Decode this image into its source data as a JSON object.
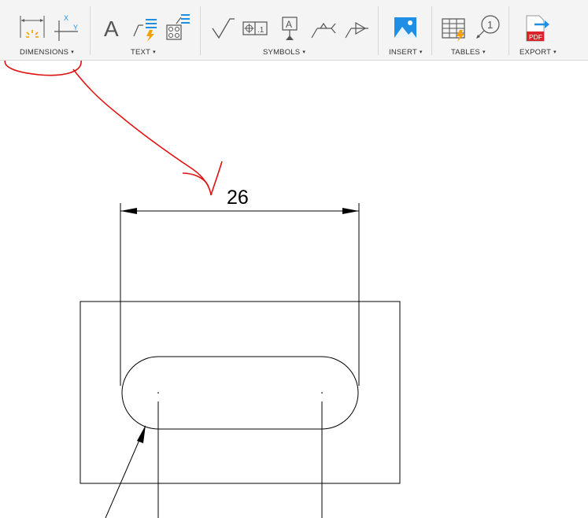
{
  "toolbar": {
    "groups": [
      {
        "label": "DIMENSIONS",
        "icons": [
          "linear-dimension-icon",
          "ordinate-dimension-icon"
        ]
      },
      {
        "label": "TEXT",
        "icons": [
          "text-icon",
          "leader-text-icon",
          "hole-thread-note-icon"
        ]
      },
      {
        "label": "SYMBOLS",
        "icons": [
          "surface-texture-icon",
          "feature-control-frame-icon",
          "datum-identifier-icon",
          "welding-symbol-icon",
          "taper-slope-icon"
        ]
      },
      {
        "label": "INSERT",
        "icons": [
          "insert-image-icon"
        ]
      },
      {
        "label": "TABLES",
        "icons": [
          "table-icon",
          "balloon-icon"
        ]
      },
      {
        "label": "EXPORT",
        "icons": [
          "export-pdf-icon"
        ]
      }
    ],
    "caret": "▾",
    "icon_glyphs": {
      "text": "A",
      "datum": "A",
      "balloon": "1",
      "pdf": "PDF",
      "ordinate_x": "X",
      "ordinate_y": "Y"
    }
  },
  "drawing": {
    "dimension_value": "26"
  },
  "colors": {
    "toolbar_bg": "#f4f4f4",
    "accent_orange": "#f5a000",
    "accent_blue": "#1f8fe6",
    "annotation_red": "#e01010",
    "pdf_red": "#d9242b",
    "line": "#000000"
  }
}
